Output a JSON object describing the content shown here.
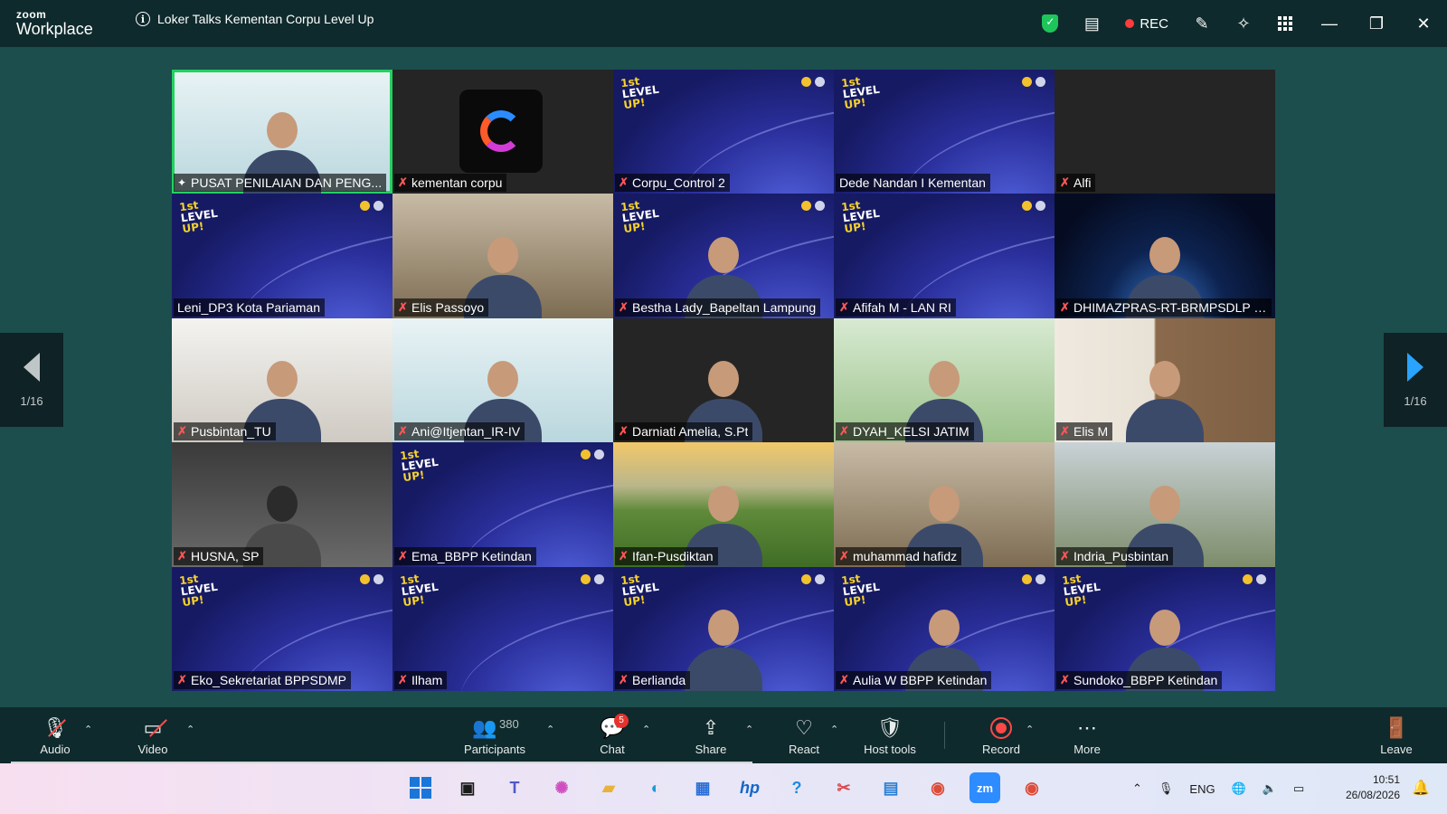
{
  "window": {
    "app_brand_small": "zoom",
    "app_brand": "Workplace",
    "meeting_title": "Loker Talks Kementan Corpu Level Up",
    "rec_label": "REC",
    "colors": {
      "titlebar": "#0f2a2c",
      "background": "#1c4d4d",
      "active_border": "#23d160",
      "rec_red": "#ff3b3b"
    }
  },
  "pager": {
    "left_label": "1/16",
    "right_label": "1/16"
  },
  "tiles": [
    {
      "name": "PUSAT PENILAIAN DAN PENG...",
      "icon": "pin-icon",
      "bg": "bg-light",
      "active": true
    },
    {
      "name": "kementan corpu",
      "icon": "mute-icon",
      "bg": "bg-dark",
      "logo": "corpu-logo"
    },
    {
      "name": "Corpu_Control 2",
      "icon": "mute-icon",
      "bg": "bg-blue"
    },
    {
      "name": "Dede Nandan I Kementan",
      "icon": "",
      "bg": "bg-blue"
    },
    {
      "name": "Alfi",
      "icon": "mute-icon",
      "bg": "bg-dark"
    },
    {
      "name": "Leni_DP3 Kota Pariaman",
      "icon": "",
      "bg": "bg-blue"
    },
    {
      "name": "Elis Passoyo",
      "icon": "mute-icon",
      "bg": "bg-people"
    },
    {
      "name": "Bestha Lady_Bapeltan Lampung",
      "icon": "mute-icon",
      "bg": "bg-blue"
    },
    {
      "name": "Afifah M - LAN RI",
      "icon": "mute-icon",
      "bg": "bg-blue"
    },
    {
      "name": "DHIMAZPRAS-RT-BRMPSDLP (...",
      "icon": "mute-icon",
      "bg": "bg-space"
    },
    {
      "name": "Pusbintan_TU",
      "icon": "mute-icon",
      "bg": "bg-room"
    },
    {
      "name": "Ani@Itjentan_IR-IV",
      "icon": "mute-icon",
      "bg": "bg-light"
    },
    {
      "name": "Darniati Amelia, S.Pt",
      "icon": "mute-icon",
      "bg": "bg-dark"
    },
    {
      "name": "DYAH_KELSI JATIM",
      "icon": "mute-icon",
      "bg": "bg-green"
    },
    {
      "name": "Elis M",
      "icon": "mute-icon",
      "bg": "bg-wood"
    },
    {
      "name": "HUSNA, SP",
      "icon": "mute-icon",
      "bg": "bg-hijab"
    },
    {
      "name": "Ema_BBPP Ketindan",
      "icon": "mute-icon",
      "bg": "bg-blue"
    },
    {
      "name": "Ifan-Pusdiktan",
      "icon": "mute-icon",
      "bg": "bg-field"
    },
    {
      "name": "muhammad hafidz",
      "icon": "mute-icon",
      "bg": "bg-people"
    },
    {
      "name": "Indria_Pusbintan",
      "icon": "mute-icon",
      "bg": "bg-office"
    },
    {
      "name": "Eko_Sekretariat BPPSDMP",
      "icon": "mute-icon",
      "bg": "bg-blue"
    },
    {
      "name": "Ilham",
      "icon": "mute-icon",
      "bg": "bg-blue"
    },
    {
      "name": "Berlianda",
      "icon": "mute-icon",
      "bg": "bg-blue"
    },
    {
      "name": "Aulia W BBPP Ketindan",
      "icon": "mute-icon",
      "bg": "bg-blue"
    },
    {
      "name": "Sundoko_BBPP Ketindan",
      "icon": "mute-icon",
      "bg": "bg-blue"
    }
  ],
  "toolbar": {
    "audio": "Audio",
    "video": "Video",
    "participants": "Participants",
    "participants_count": "380",
    "chat": "Chat",
    "chat_badge": "5",
    "share": "Share",
    "react": "React",
    "host_tools": "Host tools",
    "record": "Record",
    "more": "More",
    "leave": "Leave"
  },
  "taskbar": {
    "apps": [
      "start-icon",
      "task-view-icon",
      "teams-icon",
      "copilot-icon",
      "file-explorer-icon",
      "edge-icon",
      "store-icon",
      "hp-icon",
      "help-icon",
      "snipping-icon",
      "notepad-icon",
      "chrome-icon",
      "zoom-icon",
      "chrome-icon"
    ],
    "lang": "ENG",
    "time": "10:51",
    "date": "26/08/2026"
  }
}
